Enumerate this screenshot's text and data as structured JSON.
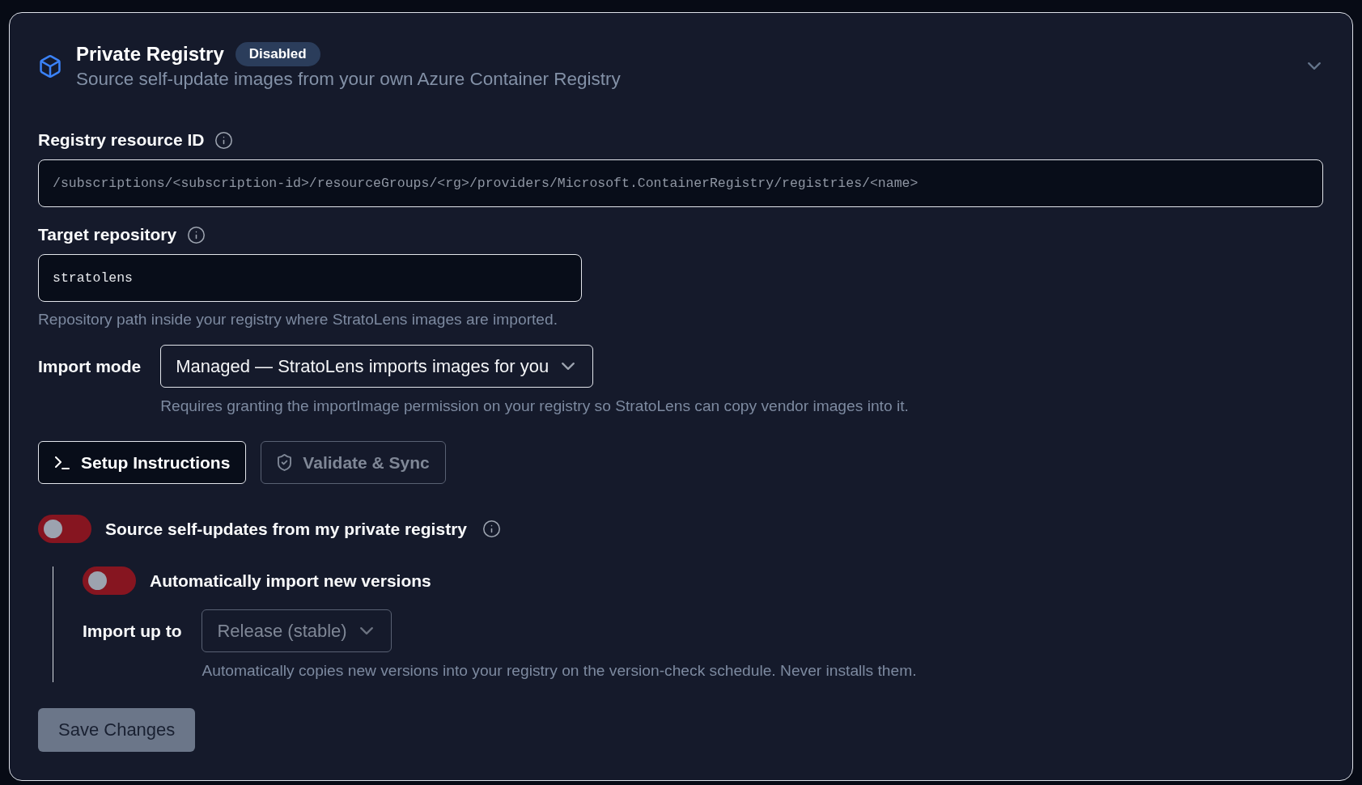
{
  "panel": {
    "title": "Private Registry",
    "badge": "Disabled",
    "subtitle": "Source self-update images from your own Azure Container Registry"
  },
  "fields": [
    {
      "label": "Registry resource ID",
      "info": true,
      "placeholder": "/subscriptions/<subscription-id>/resourceGroups/<rg>/providers/Microsoft.ContainerRegistry/registries/<name>"
    },
    {
      "label": "Target repository",
      "info": true,
      "value": "stratolens",
      "help": "Repository path inside your registry where StratoLens images are imported."
    }
  ],
  "import_mode": {
    "label": "Import mode",
    "value": "Managed — StratoLens imports images for you",
    "disabled": false,
    "help": "Requires granting the importImage permission on your registry so StratoLens can copy vendor images into it."
  },
  "actions": [
    {
      "label": "Setup Instructions",
      "disabled": false
    },
    {
      "label": "Validate & Sync",
      "disabled": true
    }
  ],
  "source_toggle": {
    "label": "Source self-updates from my private registry",
    "on": false,
    "info": true
  },
  "auto_import": {
    "label": "Automatically import new versions",
    "on": false,
    "import_up_to": {
      "label": "Import up to",
      "value": "Release (stable)",
      "disabled": true,
      "help": "Automatically copies new versions into your registry on the version-check schedule. Never installs them."
    }
  },
  "save_button": {
    "label": "Save Changes",
    "disabled": true
  }
}
